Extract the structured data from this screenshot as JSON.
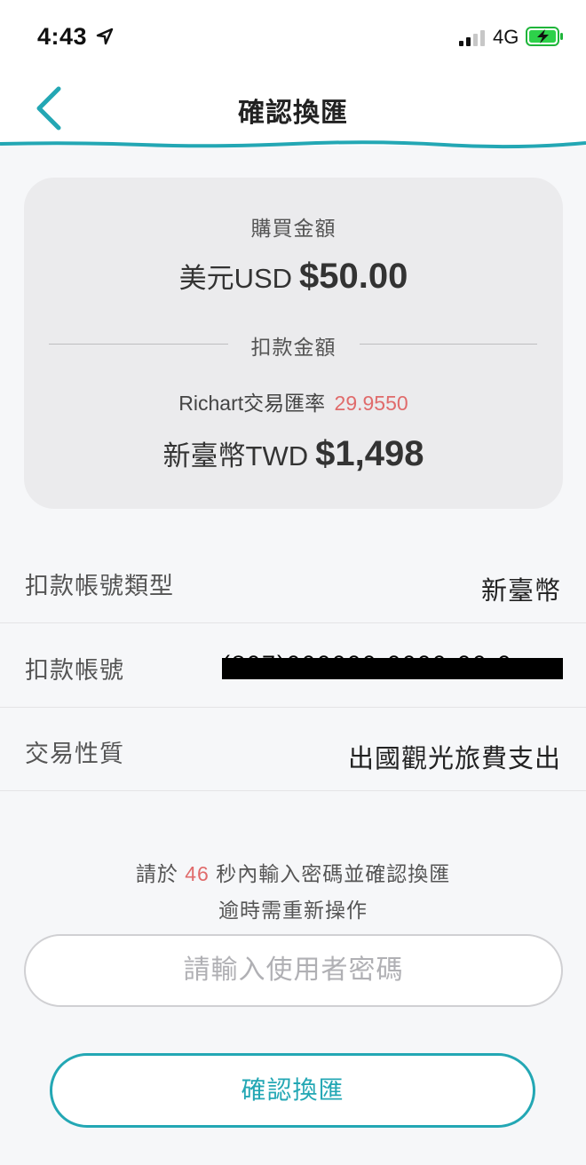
{
  "status_bar": {
    "time": "4:43",
    "network": "4G"
  },
  "nav": {
    "title": "確認換匯"
  },
  "summary": {
    "purchase_label": "購買金額",
    "purchase_currency": "美元USD",
    "purchase_amount": "$50.00",
    "deduct_label": "扣款金額",
    "rate_label": "Richart交易匯率",
    "rate_value": "29.9550",
    "twd_currency": "新臺幣TWD",
    "twd_amount": "$1,498"
  },
  "details": [
    {
      "label": "扣款帳號類型",
      "value": "新臺幣"
    },
    {
      "label": "扣款帳號",
      "value": "(807)000000-0000-00-0"
    },
    {
      "label": "交易性質",
      "value": "出國觀光旅費支出"
    }
  ],
  "prompt": {
    "prefix": "請於",
    "seconds": "46",
    "suffix": "秒內輸入密碼並確認換匯",
    "line2": "逾時需重新操作"
  },
  "password": {
    "placeholder": "請輸入使用者密碼",
    "value": ""
  },
  "confirm_button": {
    "label": "確認換匯"
  },
  "colors": {
    "accent": "#23a7b4",
    "highlight": "#e06b6b",
    "card_bg": "#ebebed",
    "page_bg": "#f6f7f9"
  }
}
